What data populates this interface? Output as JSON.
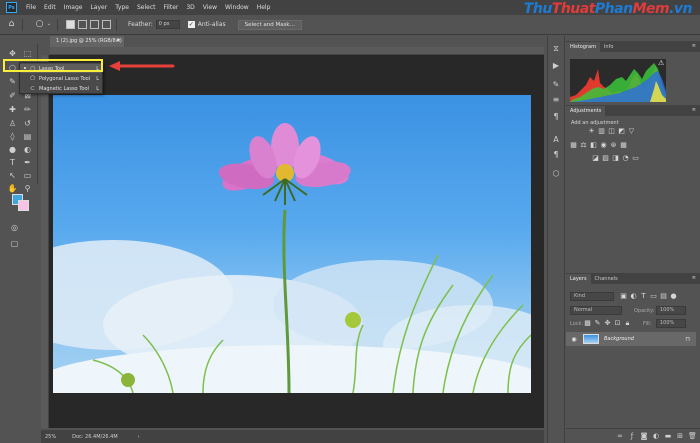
{
  "brand": {
    "parts": [
      {
        "text": "Thu",
        "color": "#1e7bd3"
      },
      {
        "text": "Thuat",
        "color": "#e23b3b"
      },
      {
        "text": "Phan",
        "color": "#1e7bd3"
      },
      {
        "text": "Mem",
        "color": "#e23b3b"
      },
      {
        "text": ".vn",
        "color": "#1e7bd3"
      }
    ]
  },
  "app": {
    "logo": "Ps"
  },
  "menu": [
    "File",
    "Edit",
    "Image",
    "Layer",
    "Type",
    "Select",
    "Filter",
    "3D",
    "View",
    "Window",
    "Help"
  ],
  "options": {
    "feather_label": "Feather:",
    "feather_value": "0 px",
    "antialias_label": "Anti-alias",
    "select_mask_label": "Select and Mask..."
  },
  "document": {
    "tab_title": "1 (2).jpg @ 25% (RGB/8#)",
    "tab_close": "×",
    "zoom": "25%",
    "doc_size": "Doc: 26.4M/26.4M",
    "status_chevron": "›"
  },
  "flyout": {
    "items": [
      {
        "label": "Lasso Tool",
        "key": "L",
        "icon": "lasso-icon",
        "selected": true
      },
      {
        "label": "Polygonal Lasso Tool",
        "key": "L",
        "icon": "polygonal-lasso-icon",
        "selected": false
      },
      {
        "label": "Magnetic Lasso Tool",
        "key": "L",
        "icon": "magnetic-lasso-icon",
        "selected": false
      }
    ]
  },
  "panels": {
    "top_tabs": [
      "Histogram",
      "Info"
    ],
    "adjustments": {
      "tab": "Adjustments",
      "title": "Add an adjustment"
    },
    "layers": {
      "tabs": [
        "Layers",
        "Channels"
      ],
      "kind_placeholder": "Kind",
      "blend_mode": "Normal",
      "opacity_label": "Opacity:",
      "opacity_value": "100%",
      "lock_label": "Lock:",
      "fill_label": "Fill:",
      "fill_value": "100%",
      "layer_name": "Background"
    }
  },
  "colors": {
    "highlight": "#f8ef3c",
    "arrow": "#e5403a",
    "foreground": "#40a4de",
    "background": "#f6c3e6"
  }
}
